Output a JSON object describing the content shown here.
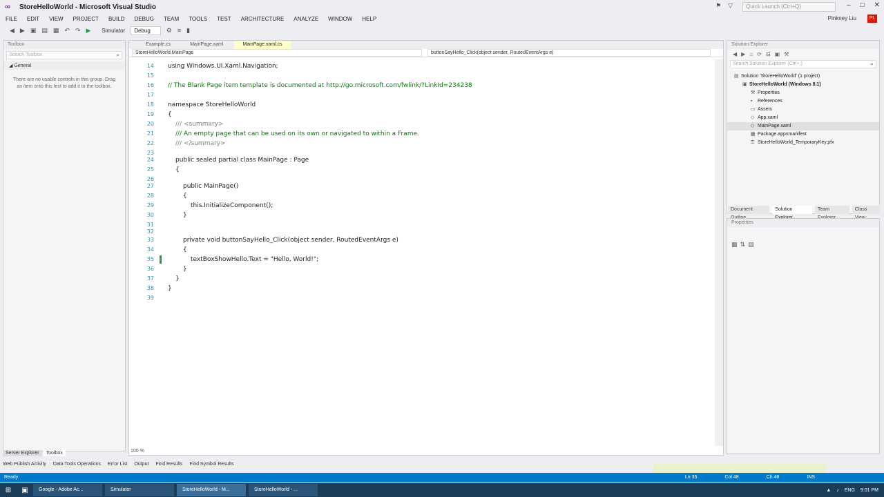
{
  "window": {
    "title": "StoreHelloWorld - Microsoft Visual Studio",
    "quick_launch_placeholder": "Quick Launch (Ctrl+Q)",
    "user": "Pinkney Liu",
    "user_initials": "PL"
  },
  "menu": [
    "FILE",
    "EDIT",
    "VIEW",
    "PROJECT",
    "BUILD",
    "DEBUG",
    "TEAM",
    "TOOLS",
    "TEST",
    "ARCHITECTURE",
    "ANALYZE",
    "WINDOW",
    "HELP"
  ],
  "toolbar": {
    "run_target": "Simulator",
    "config": "Debug"
  },
  "toolbox": {
    "header": "Toolbox",
    "search_placeholder": "Search Toolbox",
    "group": "General",
    "empty_text": "There are no usable controls in this group. Drag an item onto this text to add it to the toolbox."
  },
  "left_tabs": [
    "Server Explorer",
    "Toolbox"
  ],
  "editor": {
    "tabs": [
      "Example.cs",
      "MainPage.xaml",
      "MainPage.xaml.cs"
    ],
    "nav_left": "StoreHelloWorld.MainPage",
    "nav_right": "buttonSayHello_Click(object sender, RoutedEventArgs e)",
    "zoom": "100 %",
    "lines": [
      {
        "n": "14",
        "text": "using Windows.UI.Xaml.Navigation;",
        "indent": 0,
        "color": "#1e1e1e"
      },
      {
        "n": "15",
        "text": "",
        "indent": 0,
        "color": "#1e1e1e"
      },
      {
        "n": "16",
        "text": "// The Blank Page item template is documented at http://go.microsoft.com/fwlink/?LinkId=234238",
        "indent": 0,
        "color": "#008000"
      },
      {
        "n": "17",
        "text": "",
        "indent": 0,
        "color": "#1e1e1e"
      },
      {
        "n": "18",
        "text": "namespace StoreHelloWorld",
        "indent": 0,
        "color": "#1e1e1e"
      },
      {
        "n": "19",
        "text": "{",
        "indent": 0,
        "color": "#1e1e1e"
      },
      {
        "n": "20",
        "text": "/// <summary>",
        "indent": 1,
        "color": "#808080"
      },
      {
        "n": "21",
        "text": "/// An empty page that can be used on its own or navigated to within a Frame.",
        "indent": 1,
        "color": "#008000"
      },
      {
        "n": "22",
        "text": "/// </summary>",
        "indent": 1,
        "color": "#808080"
      },
      {
        "n": "23",
        "text": "",
        "indent": 0,
        "color": "#1e1e1e"
      },
      {
        "n": "24",
        "text": "public sealed partial class MainPage : Page",
        "indent": 1,
        "color": "#1e1e1e"
      },
      {
        "n": "25",
        "text": "{",
        "indent": 1,
        "color": "#1e1e1e"
      },
      {
        "n": "26",
        "text": "",
        "indent": 0,
        "color": "#1e1e1e"
      },
      {
        "n": "27",
        "text": "public MainPage()",
        "indent": 2,
        "color": "#1e1e1e"
      },
      {
        "n": "28",
        "text": "{",
        "indent": 2,
        "color": "#1e1e1e"
      },
      {
        "n": "29",
        "text": "this.InitializeComponent();",
        "indent": 3,
        "color": "#1e1e1e"
      },
      {
        "n": "30",
        "text": "}",
        "indent": 2,
        "color": "#1e1e1e"
      },
      {
        "n": "31",
        "text": "",
        "indent": 0,
        "color": "#1e1e1e"
      },
      {
        "n": "32",
        "text": "",
        "indent": 0,
        "color": "#1e1e1e"
      },
      {
        "n": "33",
        "text": "private void buttonSayHello_Click(object sender, RoutedEventArgs e)",
        "indent": 2,
        "color": "#1e1e1e"
      },
      {
        "n": "34",
        "text": "{",
        "indent": 2,
        "color": "#1e1e1e"
      },
      {
        "n": "35",
        "text": "textBoxShowHello.Text = \"Hello, World!\";",
        "indent": 3,
        "color": "#1e1e1e"
      },
      {
        "n": "36",
        "text": "}",
        "indent": 2,
        "color": "#1e1e1e"
      },
      {
        "n": "37",
        "text": "}",
        "indent": 1,
        "color": "#1e1e1e"
      },
      {
        "n": "38",
        "text": "}",
        "indent": 0,
        "color": "#1e1e1e"
      },
      {
        "n": "39",
        "text": "",
        "indent": 0,
        "color": "#1e1e1e"
      }
    ]
  },
  "solution_explorer": {
    "header": "Solution Explorer",
    "search_placeholder": "Search Solution Explorer (Ctrl+;)",
    "items": [
      {
        "label": "Solution 'StoreHelloWorld' (1 project)",
        "depth": 0,
        "bold": false,
        "icon": "solution-icon"
      },
      {
        "label": "StoreHelloWorld (Windows 8.1)",
        "depth": 1,
        "bold": true,
        "icon": "project-icon"
      },
      {
        "label": "Properties",
        "depth": 2,
        "bold": false,
        "icon": "wrench-icon"
      },
      {
        "label": "References",
        "depth": 2,
        "bold": false,
        "icon": "references-icon"
      },
      {
        "label": "Assets",
        "depth": 2,
        "bold": false,
        "icon": "folder-icon"
      },
      {
        "label": "App.xaml",
        "depth": 2,
        "bold": false,
        "icon": "xaml-file-icon"
      },
      {
        "label": "MainPage.xaml",
        "depth": 2,
        "bold": false,
        "icon": "xaml-file-icon",
        "selected": true
      },
      {
        "label": "Package.appxmanifest",
        "depth": 2,
        "bold": false,
        "icon": "manifest-icon"
      },
      {
        "label": "StoreHelloWorld_TemporaryKey.pfx",
        "depth": 2,
        "bold": false,
        "icon": "key-file-icon"
      }
    ],
    "tabs": [
      "Document Outline",
      "Solution Explorer",
      "Team Explorer",
      "Class View"
    ]
  },
  "properties": {
    "header": "Properties"
  },
  "bottom_tabs": [
    "Web Publish Activity",
    "Data Tools Operations",
    "Error List",
    "Output",
    "Find Results",
    "Find Symbol Results"
  ],
  "status": {
    "text": "Ready",
    "ln": "Ln 35",
    "col": "Col 48",
    "ch": "Ch 48",
    "mode": "INS"
  },
  "taskbar": {
    "apps": [
      "Google - Adobe Ac...",
      "Simulator",
      "StoreHelloWorld - M...",
      "StoreHelloWorld - ..."
    ],
    "clock": "9:01 PM",
    "lang": "ENG"
  },
  "colors": {
    "accent": "#007acc",
    "keyword": "#0000ff",
    "type": "#2b91af",
    "comment": "#008000",
    "string": "#a31515"
  }
}
